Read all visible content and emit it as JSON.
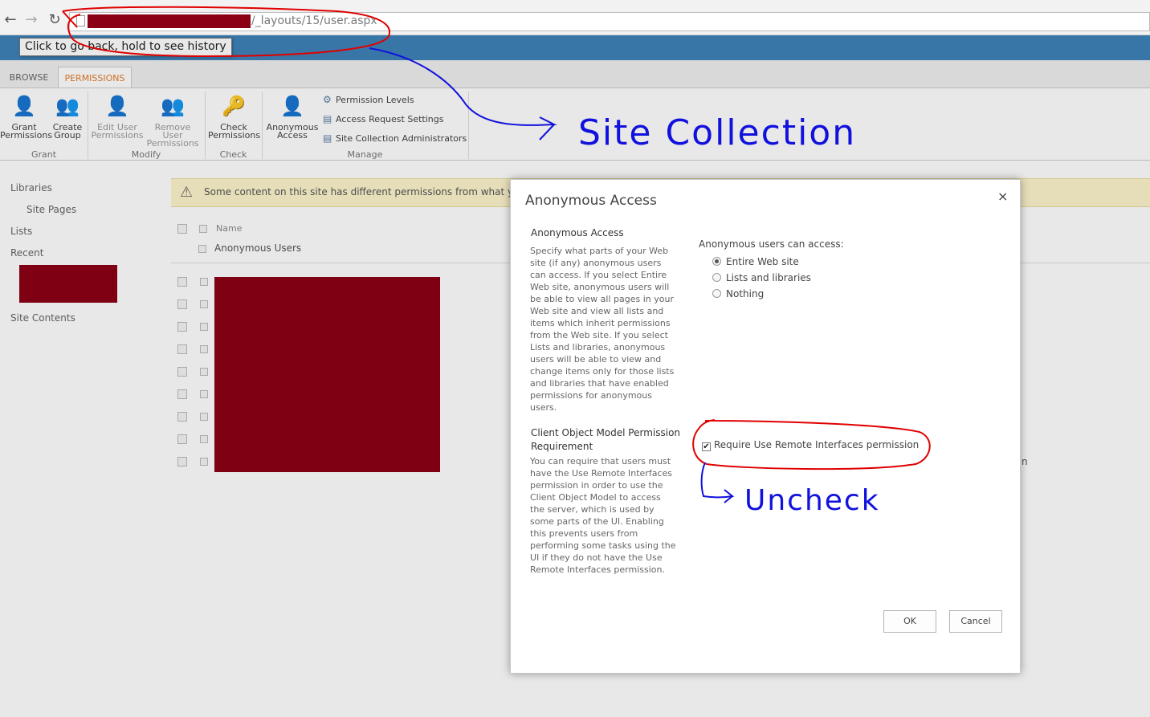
{
  "browser": {
    "back_icon": "arrow-left-icon",
    "forward_icon": "arrow-right-icon",
    "reload_icon": "reload-icon",
    "url_suffix": "/_layouts/15/user.aspx",
    "tooltip": "Click to go back, hold to see history"
  },
  "ribbon": {
    "tabs": [
      {
        "label": "BROWSE"
      },
      {
        "label": "PERMISSIONS"
      }
    ],
    "buttons": {
      "grant": {
        "line1": "Grant",
        "line2": "Permissions"
      },
      "create": {
        "line1": "Create",
        "line2": "Group"
      },
      "edit": {
        "line1": "Edit User",
        "line2": "Permissions"
      },
      "remove": {
        "line1": "Remove User",
        "line2": "Permissions"
      },
      "check": {
        "line1": "Check",
        "line2": "Permissions"
      },
      "anon": {
        "line1": "Anonymous",
        "line2": "Access"
      }
    },
    "manage_items": [
      "Permission Levels",
      "Access Request Settings",
      "Site Collection Administrators"
    ],
    "groups": [
      "Grant",
      "Modify",
      "Check",
      "Manage"
    ]
  },
  "left_nav": {
    "libraries": "Libraries",
    "site_pages": "Site Pages",
    "lists": "Lists",
    "recent": "Recent",
    "site_contents": "Site Contents"
  },
  "main": {
    "warning": "Some content on this site has different permissions from what yo",
    "column_name": "Name",
    "row_anon": "Anonymous Users",
    "behind_text": "n"
  },
  "dialog": {
    "title": "Anonymous Access",
    "close": "×",
    "section1_title": "Anonymous Access",
    "section1_desc": "Specify what parts of your Web site (if any) anonymous users can access. If you select Entire Web site, anonymous users will be able to view all pages in your Web site and view all lists and items which inherit permissions from the Web site. If you select Lists and libraries, anonymous users will be able to view and change items only for those lists and libraries that have enabled permissions for anonymous users.",
    "access_label": "Anonymous users can access:",
    "options": [
      "Entire Web site",
      "Lists and libraries",
      "Nothing"
    ],
    "selected": "Entire Web site",
    "section2_title": "Client Object Model Permission Requirement",
    "section2_desc": "You can require that users must have the Use Remote Interfaces permission in order to use the Client Object Model to access the server, which is used by some parts of the UI. Enabling this prevents users from performing some tasks using the UI if they do not have the Use Remote Interfaces permission.",
    "checkbox_label": "Require Use Remote Interfaces permission",
    "checkbox_checked": true,
    "ok": "OK",
    "cancel": "Cancel"
  },
  "annotations": {
    "site_collection": "Site Collection",
    "uncheck": "Uncheck",
    "color": "#1111dd",
    "circle_color": "#e00000"
  }
}
